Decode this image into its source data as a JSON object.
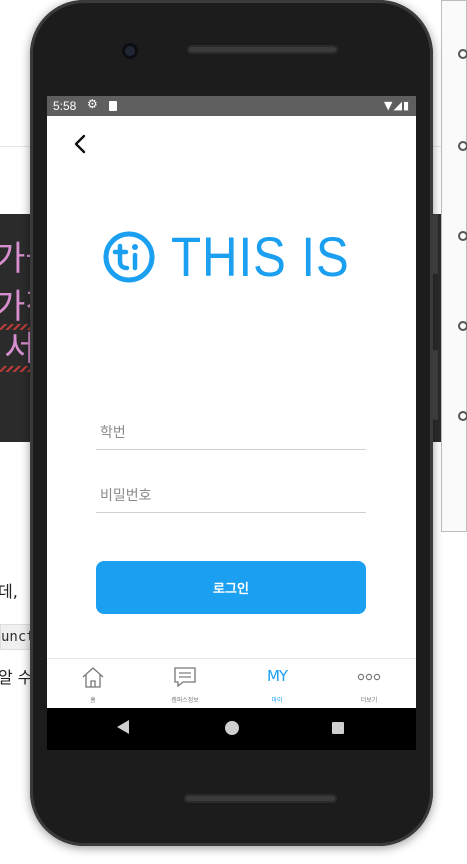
{
  "background": {
    "dark_text_lines": [
      "가들",
      "가적",
      "서"
    ],
    "text_lines": [
      "데, ",
      "알 수"
    ],
    "code_snippet": "unct"
  },
  "status_bar": {
    "time": "5:58",
    "icons": [
      "gear-icon",
      "sd-card-icon",
      "wifi-icon",
      "signal-icon",
      "battery-icon"
    ]
  },
  "header": {
    "back_icon": "chevron-left-icon"
  },
  "logo": {
    "text": "THIS IS",
    "color": "#1a9ff1"
  },
  "form": {
    "student_id_placeholder": "학번",
    "password_placeholder": "비밀번호",
    "login_label": "로그인"
  },
  "tabbar": {
    "items": [
      {
        "label": "홈",
        "icon": "home-icon"
      },
      {
        "label": "캠퍼스정보",
        "icon": "chat-icon"
      },
      {
        "label": "마이",
        "icon": "my-icon",
        "icon_text": "MY",
        "active": true
      },
      {
        "label": "더보기",
        "icon": "more-icon",
        "icon_text": "ooo"
      }
    ]
  },
  "navbar": {
    "icons": [
      "back-triangle-icon",
      "home-circle-icon",
      "recents-square-icon"
    ]
  },
  "colors": {
    "accent": "#1a9ff1",
    "status_bar": "#5f5f5f",
    "frame": "#1c1c1c"
  }
}
